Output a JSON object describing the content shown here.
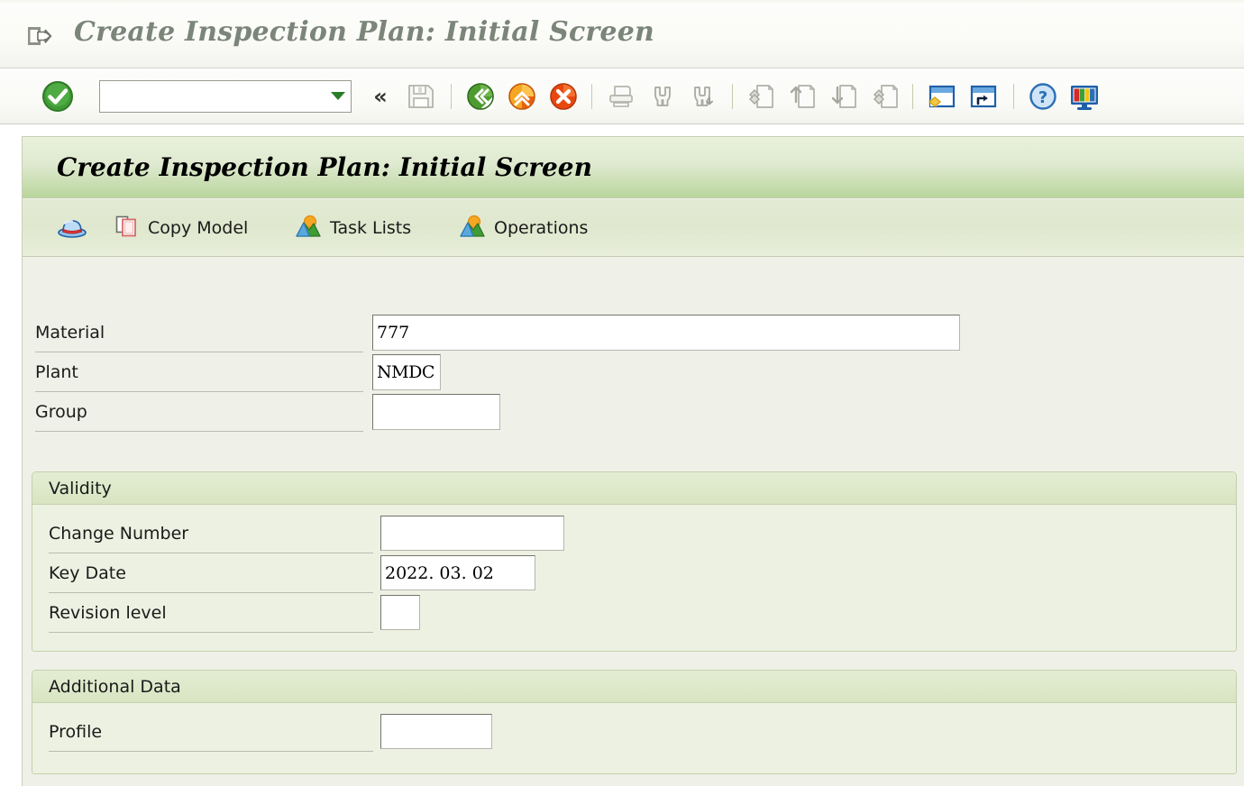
{
  "window": {
    "title": "Create Inspection Plan: Initial Screen",
    "title_icon": "exit-box-icon"
  },
  "toolbar": {
    "ok_icon": "green-check-circle-icon",
    "command_field": {
      "value": "",
      "placeholder": ""
    },
    "dropdown_icon": "dropdown-arrow-icon",
    "collapse_icon": "double-chevron-left-icon",
    "buttons": [
      {
        "name": "save-button",
        "icon": "floppy-disk-icon",
        "enabled": false
      },
      {
        "name": "back-button",
        "icon": "green-back-arrow-icon",
        "enabled": true
      },
      {
        "name": "exit-button",
        "icon": "orange-up-arrow-icon",
        "enabled": true
      },
      {
        "name": "cancel-button",
        "icon": "red-cancel-icon",
        "enabled": true
      },
      {
        "name": "print-button",
        "icon": "printer-icon",
        "enabled": false
      },
      {
        "name": "find-button",
        "icon": "binoculars-icon",
        "enabled": false
      },
      {
        "name": "find-next-button",
        "icon": "binoculars-next-icon",
        "enabled": false
      },
      {
        "name": "first-page-button",
        "icon": "first-page-icon",
        "enabled": false
      },
      {
        "name": "previous-page-button",
        "icon": "previous-page-icon",
        "enabled": false
      },
      {
        "name": "next-page-button",
        "icon": "next-page-icon",
        "enabled": false
      },
      {
        "name": "last-page-button",
        "icon": "last-page-icon",
        "enabled": false
      },
      {
        "name": "create-session-button",
        "icon": "new-window-icon",
        "enabled": true
      },
      {
        "name": "create-shortcut-button",
        "icon": "shortcut-window-icon",
        "enabled": true
      },
      {
        "name": "help-button",
        "icon": "question-circle-icon",
        "enabled": true
      },
      {
        "name": "customize-button",
        "icon": "monitor-layout-icon",
        "enabled": true
      }
    ]
  },
  "screen": {
    "heading": "Create Inspection Plan: Initial Screen",
    "app_toolbar": [
      {
        "name": "inspection-plan-button",
        "icon": "blue-hat-icon",
        "label": ""
      },
      {
        "name": "copy-model-button",
        "icon": "copy-icon",
        "label": "Copy Model"
      },
      {
        "name": "task-lists-button",
        "icon": "mountain-sunrise-icon",
        "label": "Task Lists"
      },
      {
        "name": "operations-button",
        "icon": "mountain-sunrise-icon",
        "label": "Operations"
      }
    ],
    "fields": [
      {
        "name": "material",
        "label": "Material",
        "value": "777"
      },
      {
        "name": "plant",
        "label": "Plant",
        "value": "NMDC"
      },
      {
        "name": "group",
        "label": "Group",
        "value": ""
      }
    ],
    "groups": [
      {
        "name": "validity",
        "title": "Validity",
        "fields": [
          {
            "name": "change-number",
            "label": "Change Number",
            "value": ""
          },
          {
            "name": "key-date",
            "label": "Key Date",
            "value": "2022. 03. 02"
          },
          {
            "name": "revision-level",
            "label": "Revision level",
            "value": ""
          }
        ]
      },
      {
        "name": "additional-data",
        "title": "Additional Data",
        "fields": [
          {
            "name": "profile",
            "label": "Profile",
            "value": ""
          }
        ]
      }
    ]
  },
  "colors": {
    "title_text": "#7b8579",
    "band_green_top": "#e9f0dc",
    "band_green_bottom": "#b9d59c",
    "content_bg": "#eff1e8",
    "group_bg": "#edf1e2",
    "accent_green": "#2a7d28"
  }
}
